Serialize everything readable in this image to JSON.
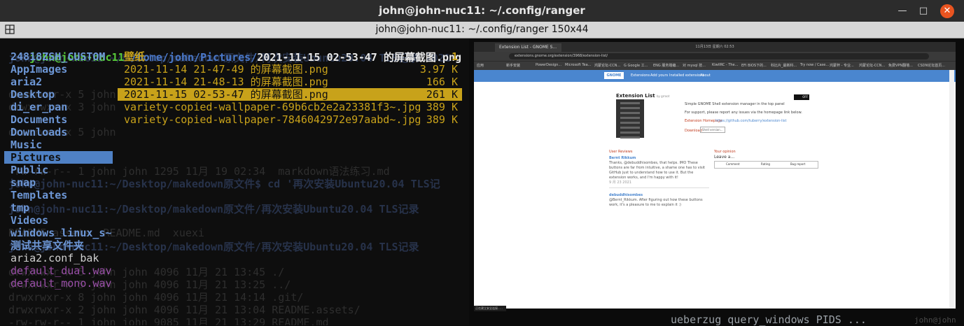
{
  "window": {
    "title": "john@john-nuc11: ~/.config/ranger",
    "buttons": {
      "minimize": "—",
      "maximize": "□",
      "close": "✕"
    }
  },
  "tab": {
    "title": "john@john-nuc11: ~/.config/ranger 150x44"
  },
  "ranger": {
    "path_user": "john@john-nuc11",
    "path_dir": " /home/john/Pictures/",
    "path_file": "2021-11-15 02-53-47 的屏幕截图.png",
    "left_items": [
      {
        "name": "24818ZSH_CUSTOM",
        "kind": "dir"
      },
      {
        "name": "AppImages",
        "kind": "dir"
      },
      {
        "name": "aria2",
        "kind": "dir"
      },
      {
        "name": "Desktop",
        "kind": "dir"
      },
      {
        "name": "di_er_pan",
        "kind": "dir"
      },
      {
        "name": "Documents",
        "kind": "dir"
      },
      {
        "name": "Downloads",
        "kind": "dir"
      },
      {
        "name": "Music",
        "kind": "dir"
      },
      {
        "name": "Pictures",
        "kind": "sel"
      },
      {
        "name": "Public",
        "kind": "dir"
      },
      {
        "name": "snap",
        "kind": "dir"
      },
      {
        "name": "Templates",
        "kind": "dir"
      },
      {
        "name": "tmp",
        "kind": "dir"
      },
      {
        "name": "Videos",
        "kind": "dir"
      },
      {
        "name": "windows_linux_s~",
        "kind": "dir"
      },
      {
        "name": "测试共享文件夹",
        "kind": "dir"
      },
      {
        "name": "aria2.conf_bak",
        "kind": "plain"
      },
      {
        "name": "default_dual.wav",
        "kind": "wav"
      },
      {
        "name": "default_mono.wav",
        "kind": "wav"
      }
    ],
    "mid_header": {
      "name": "壁纸",
      "count": "1"
    },
    "mid_rows": [
      {
        "name": "2021-11-14 21-47-49 的屏幕截图.png",
        "size": "3.97 K",
        "selected": false
      },
      {
        "name": "2021-11-14 21-48-13 的屏幕截图.png",
        "size": "166 K",
        "selected": false
      },
      {
        "name": "2021-11-15 02-53-47 的屏幕截图.png",
        "size": "261 K",
        "selected": true
      },
      {
        "name": "variety-copied-wallpaper-69b6cb2e2a23381f3~.jpg",
        "size": "389 K",
        "selected": false
      },
      {
        "name": "variety-copied-wallpaper-7846042972e97aabd~.jpg",
        "size": "389 K",
        "selected": false
      }
    ],
    "ghost_lines": [
      {
        "text": "john@john-nuc11 ~/Desktop/makedown原文件/再次安装Ubuntu20.04 TLS记录 2021",
        "row": 0,
        "g2": true
      },
      {
        "text": "drwxrwxr-x 5 john",
        "row": 3,
        "g2": false
      },
      {
        "text": "drwxrwxr-x 3 john",
        "row": 4,
        "g2": false
      },
      {
        "text": "drwxrwxr-x 5 john",
        "row": 6,
        "g2": false
      },
      {
        "text": "-rw-rw-r-- 1 john john 1295 11月 19 02:34  markdown语法练习.md",
        "row": 9,
        "g2": false
      },
      {
        "text": "john@john-nuc11:~/Desktop/makedown原文件$ cd '再次安装Ubuntu20.04 TLS记",
        "row": 10,
        "g2": true
      },
      {
        "text": "john@john-nuc11:~/Desktop/makedown原文件/再次安装Ubuntu20.04 TLS记录",
        "row": 12,
        "g2": true
      },
      {
        "text": "README.assets  README.md  xuexi",
        "row": 14,
        "g2": false
      },
      {
        "text": "john@john-nuc11:~/Desktop/makedown原文件/再次安装Ubuntu20.04 TLS记录",
        "row": 15,
        "g2": true
      },
      {
        "text": "drwxrwxr-x 5 john john 4096 11月 21 13:45 ./",
        "row": 17,
        "g2": false
      },
      {
        "text": "drwxrwxr-x 5 john john 4096 11月 21 13:25 ../",
        "row": 18,
        "g2": false
      },
      {
        "text": "drwxrwxr-x 8 john john 4096 11月 21 14:14 .git/",
        "row": 19,
        "g2": false
      },
      {
        "text": "drwxrwxr-x 2 john john 4096 11月 21 13:04 README.assets/",
        "row": 20,
        "g2": false
      },
      {
        "text": "-rw-rw-r-- 1 john john 9085 11月 21 13:29 README.md",
        "row": 21,
        "g2": false
      },
      {
        "text": "drwxrwxr-x 3 john john 4096 11月 21 13:45 xuexi/",
        "row": 22,
        "g2": false
      }
    ],
    "preview_footer": "ueberzug query_windows PIDS ...",
    "preview_footer2": "john@john"
  },
  "preview": {
    "chrome_tab": "Extension List - GNOME S...",
    "chrome_title": "11月13日 星期六 02:53",
    "url": "extensions.gnome.org/extension/3968/extension-list/",
    "bookmarks": [
      "应用",
      "新手安装",
      "PowerDesign...",
      "Microsoft Tea...",
      "鸿蒙论坛-CCN...",
      "G Google 工...",
      "ENG 服务端编...",
      "对 mysql 技...",
      "KiwiIRC - The...",
      "EFI BIOS下的...",
      "科比片_最新科...",
      "Try now / Case...",
      "鸿蒙杯 - 专业...",
      "鸿蒙论坛-CCN...",
      "免费VPN翻墙...",
      "CSDN论坛首页..."
    ],
    "nav": [
      "Extensions",
      "Add yours",
      "Installed extensions",
      "About"
    ],
    "logo": "GNOME",
    "ext_name": "Extension List",
    "ext_by": "by grroot",
    "ext_desc1": "Simple GNOME Shell extension manager in the top panel",
    "ext_desc2": "For support, please report any issues via the homepage link below.",
    "homepage_label": "Extension Homepage",
    "homepage_url": "https://github.com/tuberry/extension-list",
    "download_label": "Download",
    "download_select": "Shell version...",
    "toggle": "OFF",
    "reviews_title": "User Reviews",
    "opinion_title": "Your opinion",
    "opinion_sub": "Leave a...",
    "opinion_buttons": [
      "Comment",
      "Rating",
      "Bug report"
    ],
    "review1_name": "Bernt Rikkum",
    "review1_text": "Thanks, @debuddhisombes, that helps. IMO These buttons are far from intuitive, a shame one has to visit GitHub just to understand how to use it. But the extension works, and I'm happy with it!",
    "review1_date": "9 月 23 2021",
    "review2_name": "debuddhisombes",
    "review2_text": "@Bernt_Rikkum. After figuring out how these buttons work, it's a pleasure to me to explain it :)",
    "status": "正在建立安全连接..."
  }
}
